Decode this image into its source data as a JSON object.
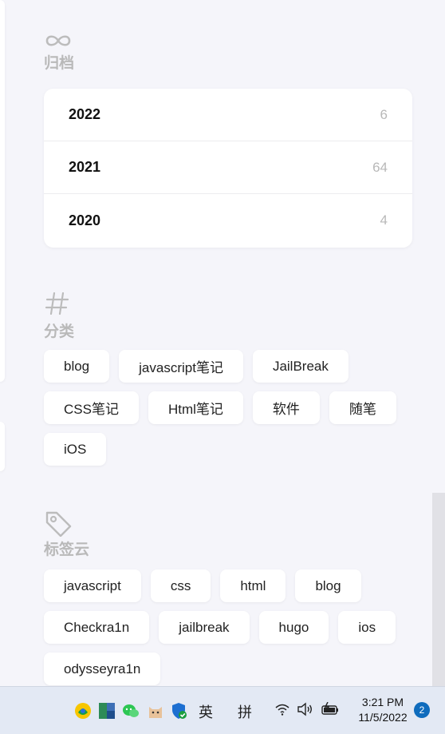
{
  "archive": {
    "title": "归档",
    "icon": "infinity-icon",
    "rows": [
      {
        "year": "2022",
        "count": "6"
      },
      {
        "year": "2021",
        "count": "64"
      },
      {
        "year": "2020",
        "count": "4"
      }
    ]
  },
  "categories": {
    "title": "分类",
    "icon": "hash-icon",
    "items": [
      "blog",
      "javascript笔记",
      "JailBreak",
      "CSS笔记",
      "Html笔记",
      "软件",
      "随笔",
      "iOS"
    ]
  },
  "tag_cloud": {
    "title": "标签云",
    "icon": "tag-icon",
    "items": [
      "javascript",
      "css",
      "html",
      "blog",
      "Checkra1n",
      "jailbreak",
      "hugo",
      "ios",
      "odysseyra1n"
    ]
  },
  "taskbar": {
    "ime_lang": "英",
    "ime_mode": "拼",
    "time": "3:21 PM",
    "date": "11/5/2022",
    "notification_count": "2"
  }
}
